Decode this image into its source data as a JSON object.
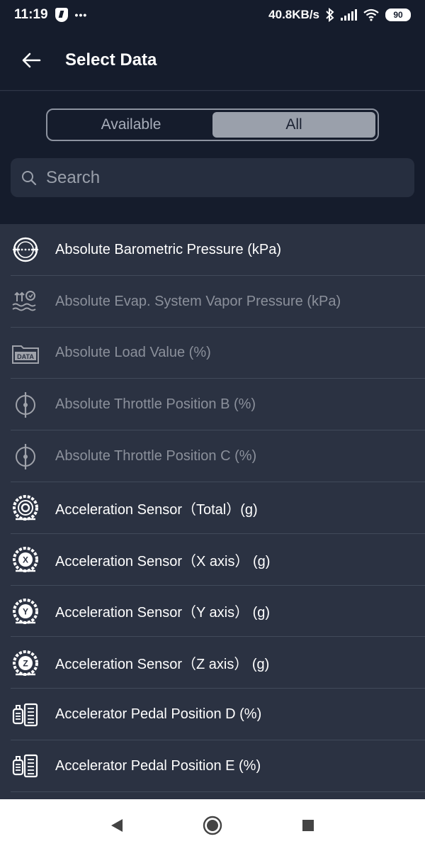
{
  "status_bar": {
    "time": "11:19",
    "dots": "•••",
    "net_speed": "40.8KB/s",
    "battery": "90"
  },
  "header": {
    "title": "Select Data"
  },
  "filter": {
    "tabs": [
      {
        "label": "Available",
        "active": false
      },
      {
        "label": "All",
        "active": true
      }
    ]
  },
  "search": {
    "placeholder": "Search"
  },
  "list": {
    "items": [
      {
        "label": "Absolute Barometric Pressure (kPa)",
        "icon": "pressure-gauge-icon",
        "enabled": true
      },
      {
        "label": "Absolute Evap. System Vapor Pressure (kPa)",
        "icon": "vapor-pressure-icon",
        "enabled": false
      },
      {
        "label": "Absolute Load Value (%)",
        "icon": "data-folder-icon",
        "enabled": false
      },
      {
        "label": "Absolute Throttle Position B (%)",
        "icon": "throttle-icon",
        "enabled": false
      },
      {
        "label": "Absolute Throttle Position C (%)",
        "icon": "throttle-icon",
        "enabled": false
      },
      {
        "label": "Acceleration Sensor（Total）(g)",
        "icon": "acceleration-total-icon",
        "enabled": true
      },
      {
        "label": "Acceleration Sensor（X axis） (g)",
        "icon": "acceleration-x-icon",
        "enabled": true
      },
      {
        "label": "Acceleration Sensor（Y axis） (g)",
        "icon": "acceleration-y-icon",
        "enabled": true
      },
      {
        "label": "Acceleration Sensor（Z axis） (g)",
        "icon": "acceleration-z-icon",
        "enabled": true
      },
      {
        "label": "Accelerator Pedal Position D (%)",
        "icon": "pedal-icon",
        "enabled": true
      },
      {
        "label": "Accelerator Pedal Position E (%)",
        "icon": "pedal-icon",
        "enabled": true
      }
    ]
  },
  "colors": {
    "background": "#151c2c",
    "list_background": "#2b3242",
    "active_segment": "#9aa0ab",
    "disabled_text": "#8b909b"
  }
}
